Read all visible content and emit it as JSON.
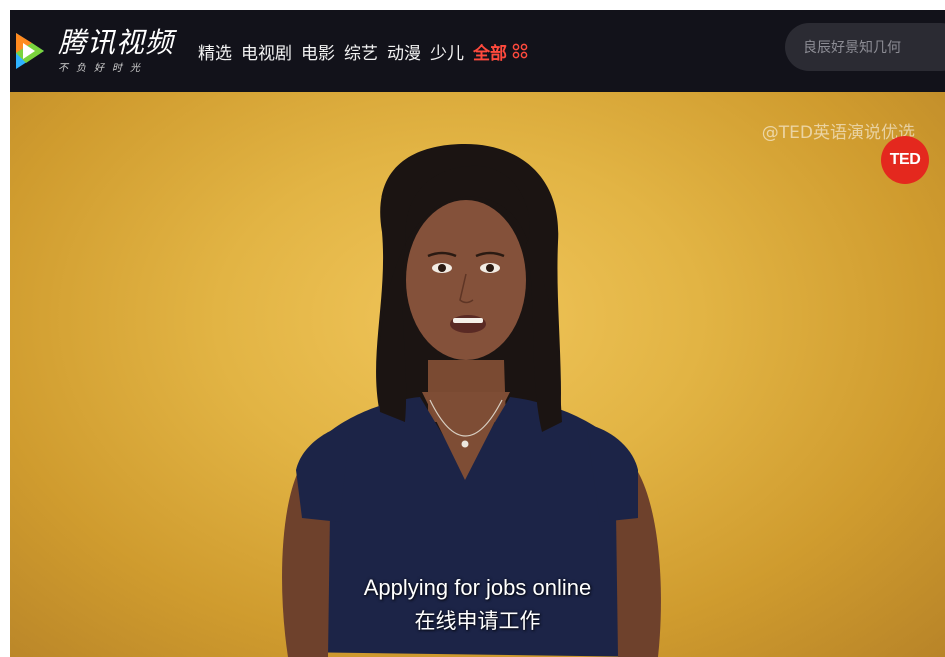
{
  "header": {
    "logo_title": "腾讯视频",
    "logo_slogan": "不负好时光",
    "nav": [
      {
        "label": "精选",
        "active": false
      },
      {
        "label": "电视剧",
        "active": false
      },
      {
        "label": "电影",
        "active": false
      },
      {
        "label": "综艺",
        "active": false
      },
      {
        "label": "动漫",
        "active": false
      },
      {
        "label": "少儿",
        "active": false
      },
      {
        "label": "全部",
        "active": true
      }
    ],
    "more_icon": "grid-dots-icon",
    "search_placeholder": "良辰好景知几何"
  },
  "video": {
    "watermark": "@TED英语演说优选",
    "badge": "TED",
    "subtitle_en": "Applying for jobs online",
    "subtitle_zh": "在线申请工作"
  },
  "colors": {
    "nav_bg": "#12121a",
    "accent": "#ff4a3d",
    "ted_red": "#e4281e"
  }
}
